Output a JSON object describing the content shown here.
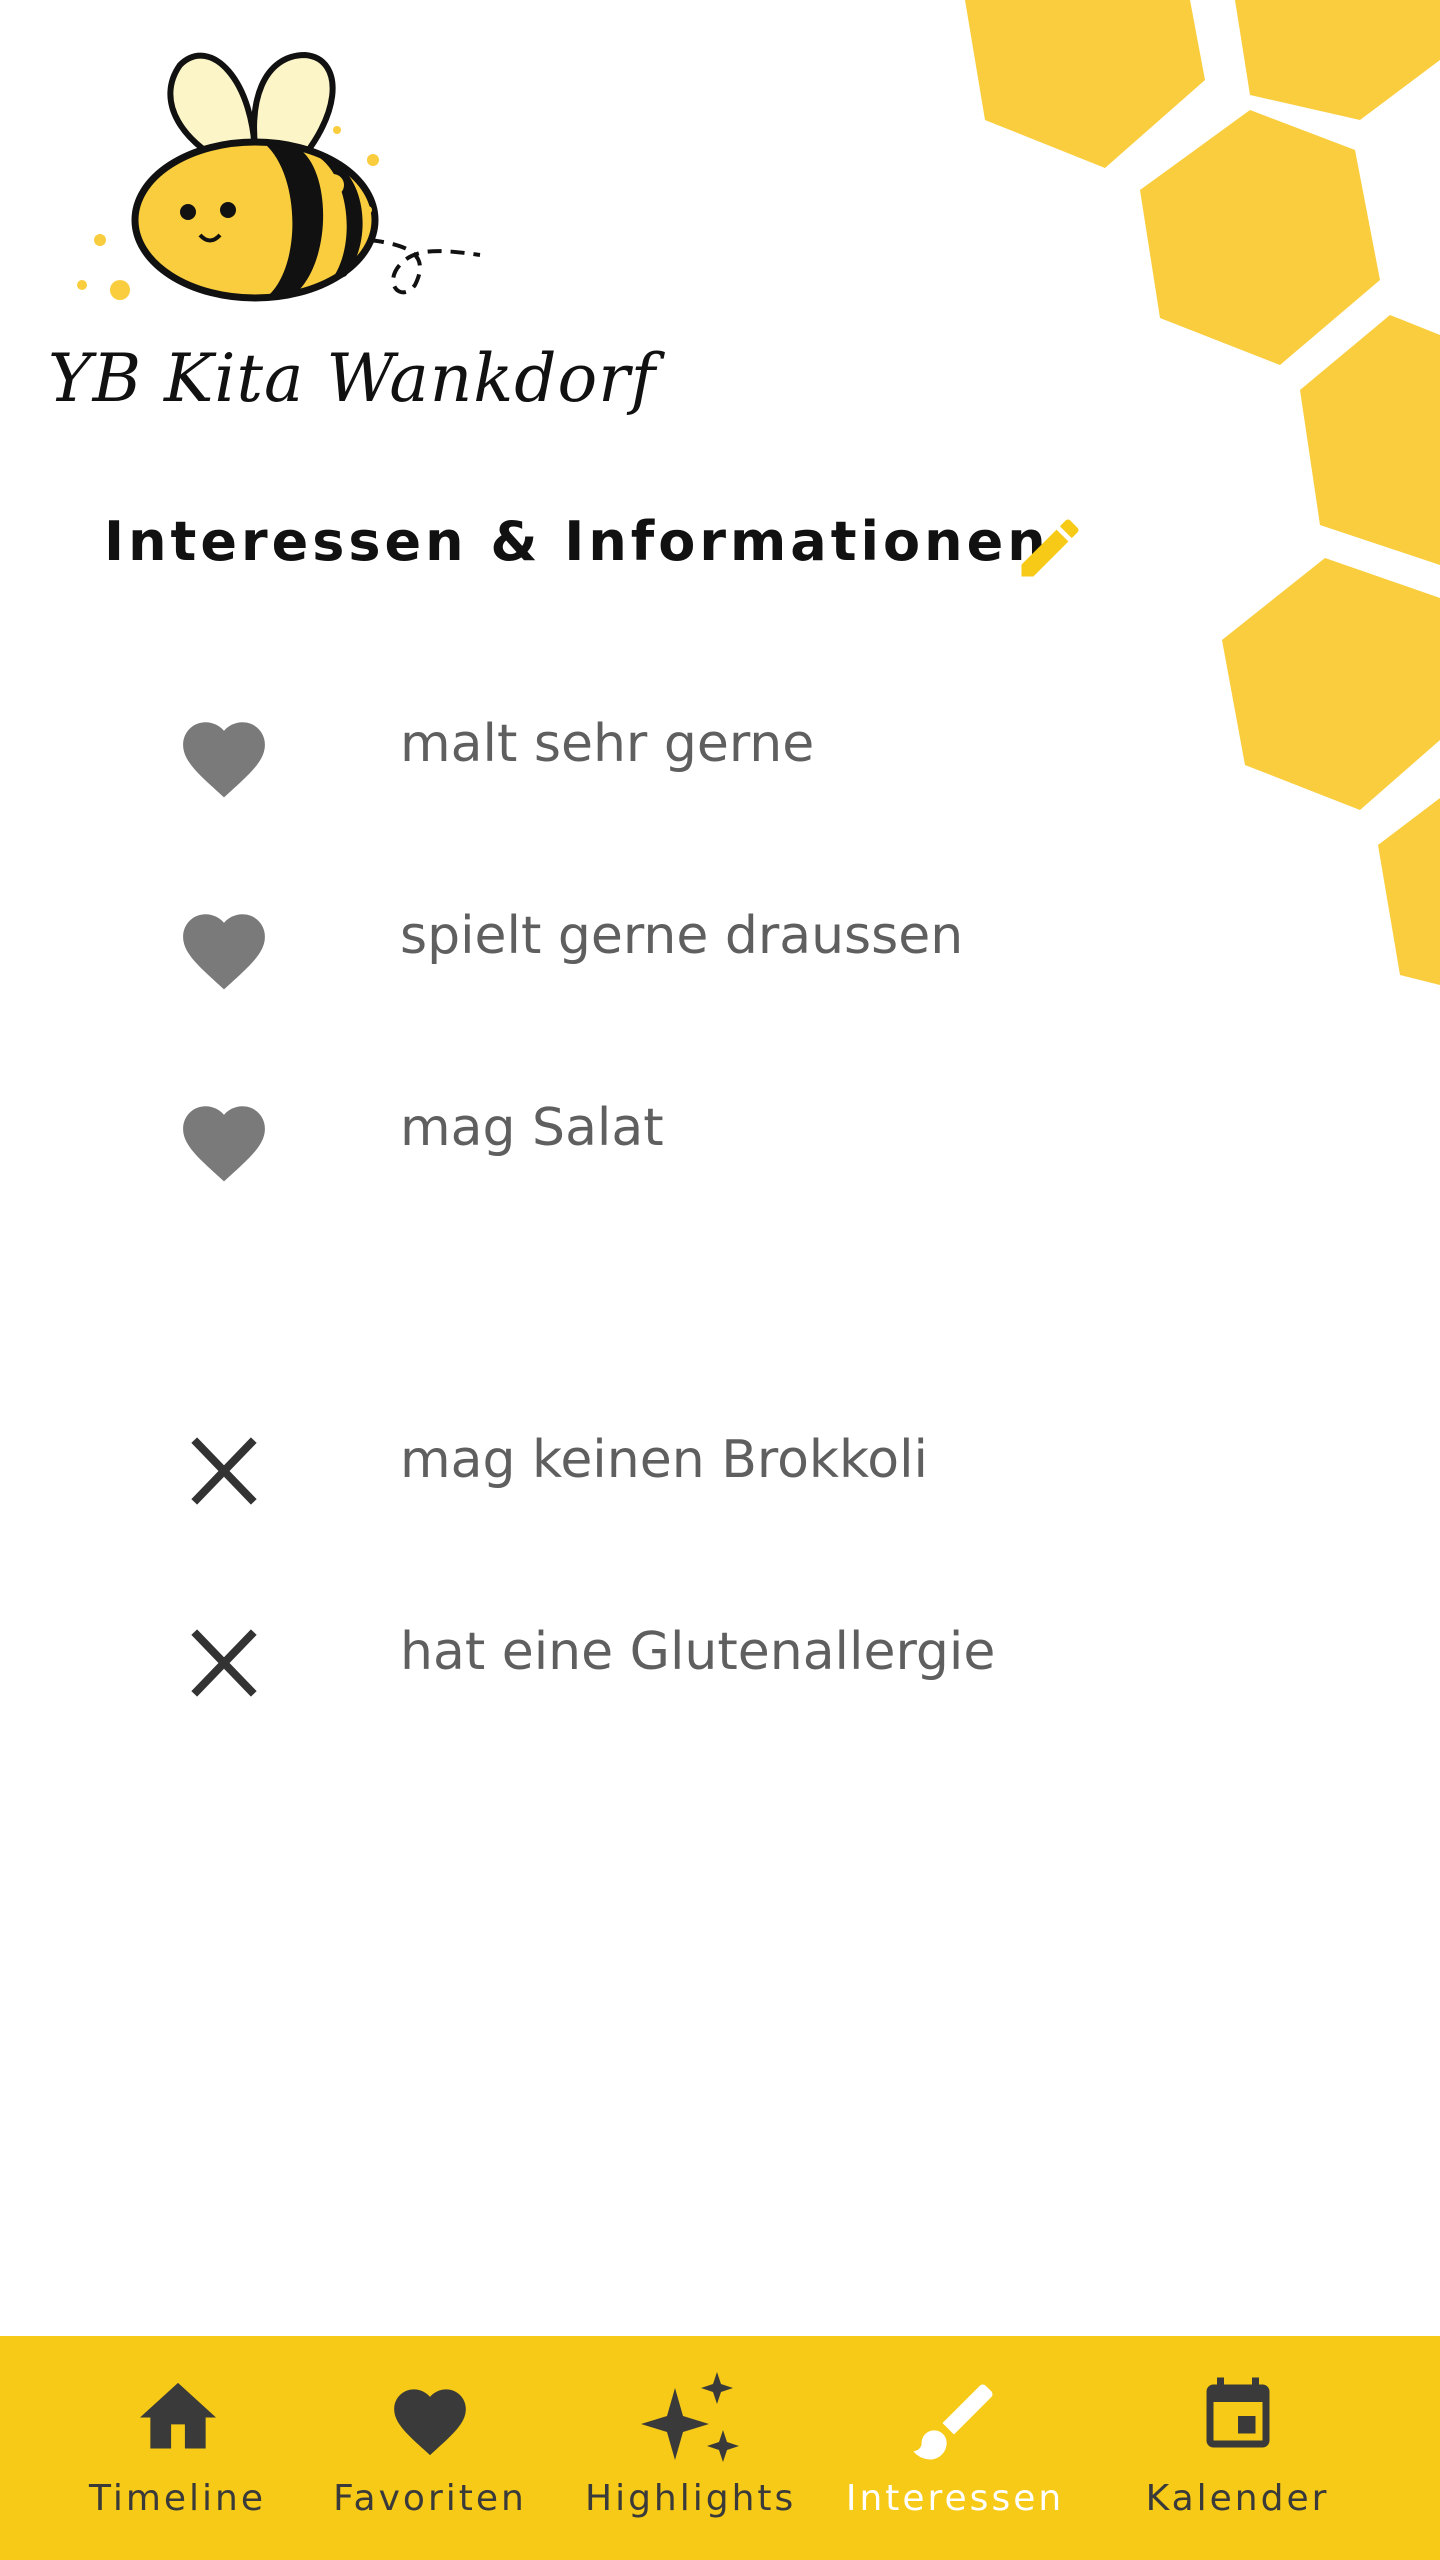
{
  "app": {
    "brand_name": "YB Kita Wankdorf",
    "colors": {
      "accent": "#f6ca16",
      "honeycomb": "#f9cd3d",
      "icon_grey": "#7a7a7a",
      "text": "#5f5f5f"
    }
  },
  "section": {
    "title": "Interessen & Informationen",
    "edit_icon": "pencil-icon"
  },
  "likes": [
    {
      "icon": "heart-icon",
      "label": "malt sehr gerne"
    },
    {
      "icon": "heart-icon",
      "label": "spielt gerne draussen"
    },
    {
      "icon": "heart-icon",
      "label": "mag Salat"
    }
  ],
  "dislikes": [
    {
      "icon": "close-icon",
      "label": "mag keinen Brokkoli"
    },
    {
      "icon": "close-icon",
      "label": "hat eine Glutenallergie"
    }
  ],
  "nav": [
    {
      "icon": "home-icon",
      "label": "Timeline",
      "active": false
    },
    {
      "icon": "heart-icon",
      "label": "Favoriten",
      "active": false
    },
    {
      "icon": "sparkles-icon",
      "label": "Highlights",
      "active": false
    },
    {
      "icon": "paintbrush-icon",
      "label": "Interessen",
      "active": true
    },
    {
      "icon": "calendar-icon",
      "label": "Kalender",
      "active": false
    }
  ]
}
